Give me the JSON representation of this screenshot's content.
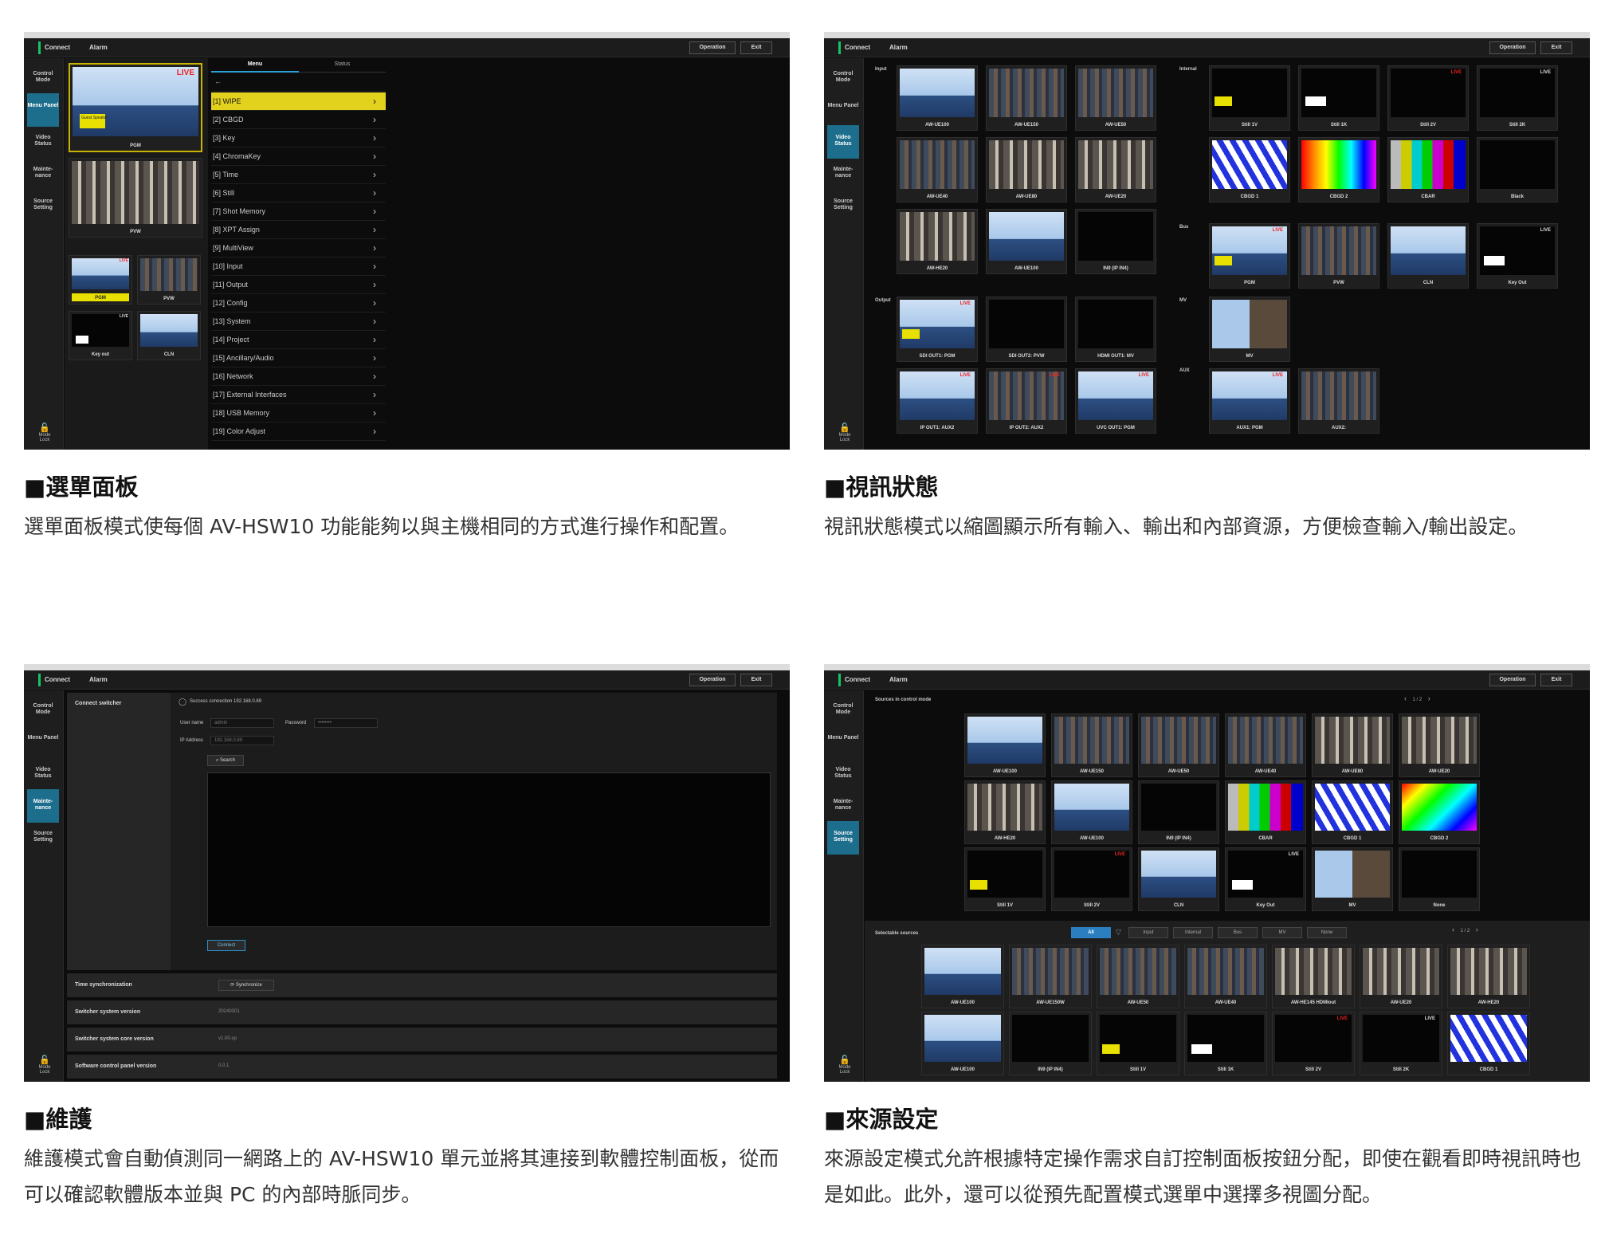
{
  "common": {
    "connect": "Connect",
    "alarm": "Alarm",
    "operation": "Operation",
    "exit": "Exit",
    "side_control": "Control Mode",
    "side_menu": "Menu Panel",
    "side_video": "Video Status",
    "side_maint": "Mainte-nance",
    "side_source": "Source Setting",
    "side_lock": "Mode Lock",
    "live": "LIVE",
    "live_small": "LIVE",
    "guest": "Guest Speaker"
  },
  "panel1": {
    "title": "■選單面板",
    "desc": "選單面板模式使每個 AV-HSW10 功能能夠以與主機相同的方式進行操作和配置。",
    "tab_menu": "Menu",
    "tab_status": "Status",
    "pgm": "PGM",
    "pvw": "PVW",
    "key_out": "Key out",
    "cln": "CLN",
    "back": "←",
    "menu_items": [
      "[1] WIPE",
      "[2] CBGD",
      "[3] Key",
      "[4] ChromaKey",
      "[5] Time",
      "[6] Still",
      "[7] Shot Memory",
      "[8] XPT Assign",
      "[9] MultiView",
      "[10] Input",
      "[11] Output",
      "[12] Config",
      "[13] System",
      "[14] Project",
      "[15] Ancillary/Audio",
      "[16] Network",
      "[17] External Interfaces",
      "[18] USB Memory",
      "[19] Color Adjust"
    ]
  },
  "panel2": {
    "title": "■視訊狀態",
    "desc": "視訊狀態模式以縮圖顯示所有輸入、輸出和內部資源，方便檢查輸入/輸出設定。",
    "sec_input": "Input",
    "sec_internal": "Internal",
    "sec_bus": "Bus",
    "sec_output": "Output",
    "sec_mv": "MV",
    "sec_aux": "AUX",
    "input": [
      "AW-UE100",
      "AW-UE150",
      "AW-UE50",
      "AW-UE40",
      "AW-UE80",
      "AW-UE20",
      "AW-HE20",
      "AW-UE100",
      "IN9 (IP IN4)"
    ],
    "internal": [
      "Still 1V",
      "Still 1K",
      "Still 2V",
      "Still 2K",
      "CBGD 1",
      "CBGD 2",
      "CBAR",
      "Black"
    ],
    "bus": [
      "PGM",
      "PVW",
      "CLN",
      "Key Out"
    ],
    "output": [
      "SDI OUT1: PGM",
      "SDI OUT2: PVW",
      "HDMI OUT1: MV",
      "IP OUT1: AUX2",
      "IP OUT2: AUX2",
      "UVC OUT1: PGM"
    ],
    "mv": "MV",
    "aux": [
      "AUX1: PGM",
      "AUX2:"
    ]
  },
  "panel3": {
    "title": "■維護",
    "desc": "維護模式會自動偵測同一網路上的 AV-HSW10 單元並將其連接到軟體控制面板，從而可以確認軟體版本並與 PC 的內部時脈同步。",
    "connect_switcher": "Connect switcher",
    "status": "Success connection 192.168.0.89",
    "user_label": "User name",
    "user_value": "admin",
    "pass_label": "Password",
    "pass_value": "••••••••",
    "ip_label": "IP Address",
    "ip_value": "192.168.0.89",
    "search": "Search",
    "connect": "Connect",
    "time_sync": "Time synchronization",
    "synchronize": "Synchronize",
    "sys_version": "Switcher system version",
    "sys_version_value": "20240301",
    "core_version": "Switcher system core version",
    "core_version_value": "v1.00-xp",
    "panel_version": "Software control panel version",
    "panel_version_value": "0.0.1"
  },
  "panel4": {
    "title": "■來源設定",
    "desc": "來源設定模式允許根據特定操作需求自訂控制面板按鈕分配，即使在觀看即時視訊時也是如此。此外，還可以從預先配置模式選單中選擇多視圖分配。",
    "sources_label": "Sources in control mode",
    "page_top": "1 / 2",
    "top": [
      "AW-UE100",
      "AW-UE150",
      "AW-UE50",
      "AW-UE40",
      "AW-UE80",
      "AW-UE20",
      "AW-HE20",
      "AW-UE100",
      "IN9 (IP IN4)",
      "CBAR",
      "CBGD 1",
      "CBGD 2",
      "Still 1V",
      "Still 2V",
      "CLN",
      "Key Out",
      "MV",
      "None"
    ],
    "selectable_label": "Selectable sources",
    "page_bottom": "1 / 2",
    "filters": [
      "All",
      "Input",
      "Internal",
      "Bus",
      "MV",
      "None"
    ],
    "bottom": [
      "AW-UE100",
      "AW-UE150W",
      "AW-UE50",
      "AW-UE40",
      "AW-HE145 HDMIout",
      "AW-UE20",
      "AW-HE20",
      "AW-UE100",
      "IN9 (IP IN4)",
      "Still 1V",
      "Still 1K",
      "Still 2V",
      "Still 2K",
      "CBGD 1"
    ]
  }
}
